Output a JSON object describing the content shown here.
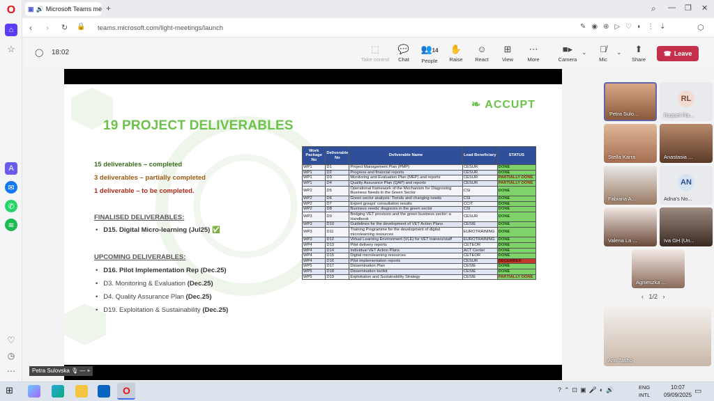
{
  "browser": {
    "tab_title": "Microsoft Teams meet",
    "url": "teams.microsoft.com/light-meetings/launch"
  },
  "meeting": {
    "timer": "18:02",
    "toolbar": {
      "take_control": "Take control",
      "chat": "Chat",
      "people": "People",
      "people_count": "14",
      "raise": "Raise",
      "react": "React",
      "view": "View",
      "more": "More",
      "camera": "Camera",
      "mic": "Mic",
      "share": "Share",
      "leave": "Leave"
    },
    "presenter_label": "Petra Sulovska"
  },
  "slide": {
    "title": "19 PROJECT DELIVERABLES",
    "logo": "ACCUPT",
    "summary": {
      "completed": "15 deliverables – completed",
      "partial": "3 deliverables – partially completed",
      "todo": "1 deliverable – to be completed."
    },
    "finalised_heading": "FINALISED DELIVERABLES:",
    "finalised": [
      {
        "text": "D15. Digital Micro-learning (Jul25) ✅"
      }
    ],
    "upcoming_heading": "UPCOMING DELIVERABLES:",
    "upcoming": [
      {
        "name": "D16. Pilot Implementation Rep",
        "date": "(Dec.25)"
      },
      {
        "name": "D3. Monitoring & Evaluation",
        "date": "(Dec.25)"
      },
      {
        "name": "D4. Quality Assurance Plan",
        "date": "(Dec.25)"
      },
      {
        "name": "D19. Exploitation & Sustainability",
        "date": "(Dec.25)"
      }
    ],
    "table": {
      "headers": [
        "Work Package No",
        "Deliverable No",
        "Deliverable Name",
        "Lead Beneficiary",
        "STATUS"
      ],
      "rows": [
        [
          "WP1",
          "D1",
          "Project Management Plan (PMP)",
          "CESUR",
          "DONE"
        ],
        [
          "WP1",
          "D2",
          "Progress and financial reports",
          "CESUR",
          "DONE"
        ],
        [
          "WP1",
          "D3",
          "Monitoring and Evaluation Plan (MEP) and reports",
          "CESUR",
          "PARTIALLY DONE"
        ],
        [
          "WP1",
          "D4",
          "Quality Assurance Plan (QAP) and reports",
          "CESUR",
          "PARTIALLY DONE"
        ],
        [
          "WP2",
          "D5",
          "Operational framework of the Mechanism for Diagnosing Business Needs in the Green Sector",
          "CSI",
          "DONE"
        ],
        [
          "WP2",
          "D6",
          "Green sector analysis: Trends and changing needs",
          "CSI",
          "DONE"
        ],
        [
          "WP2",
          "D7",
          "Expert groups' consultation results",
          "CCIT",
          "DONE"
        ],
        [
          "WP2",
          "D8",
          "Business needs' diagnosis in the green sector",
          "CSI",
          "DONE"
        ],
        [
          "WP3",
          "D9",
          "Bridging VET provision and the green business sector: a Handbook",
          "CESUR",
          "DONE"
        ],
        [
          "WP3",
          "D10",
          "Guidelines for the development of VET Action Plans",
          "CESIE",
          "DONE"
        ],
        [
          "WP3",
          "D11",
          "Training Programme for the development of digital microlearning resources",
          "EUROTRAINING",
          "DONE"
        ],
        [
          "WP3",
          "D12",
          "Virtual Learning Environment (VLE) for VET trainers/staff",
          "EUROTRAINING",
          "DONE"
        ],
        [
          "WP4",
          "D13",
          "Pilot delivery reports",
          "CETEOR",
          "DONE"
        ],
        [
          "WP4",
          "D14",
          "Individual VET Action Plans",
          "ACT Center",
          "DONE"
        ],
        [
          "WP4",
          "D15",
          "Digital microlearning resources",
          "CETEOR",
          "DONE"
        ],
        [
          "WP4",
          "D16",
          "Pilot implementation reports",
          "CESUR",
          "DECEMBER"
        ],
        [
          "WP5",
          "D17",
          "Dissemination Plan",
          "CESIE",
          "DONE"
        ],
        [
          "WP5",
          "D18",
          "Dissemination toolkit",
          "CESIE",
          "DONE"
        ],
        [
          "WP5",
          "D19",
          "Exploitation and Sustainability Strategy",
          "CESIE",
          "PARTIALLY DONE"
        ]
      ]
    }
  },
  "participants": [
    {
      "name": "Petra Sulo...",
      "initials": ""
    },
    {
      "name": "Raquel Pla...",
      "initials": "RL"
    },
    {
      "name": "Stella Karra",
      "initials": ""
    },
    {
      "name": "Anastasia ...",
      "initials": ""
    },
    {
      "name": "Fabiana A...",
      "initials": ""
    },
    {
      "name": "Adna's No...",
      "initials": "AN"
    },
    {
      "name": "Valeria La ...",
      "initials": ""
    },
    {
      "name": "Iva GH (Un...",
      "initials": ""
    },
    {
      "name": "Agnieszka ...",
      "initials": ""
    }
  ],
  "pager": "1/2",
  "self_view": "Aris Tasho",
  "taskbar": {
    "lang1": "ENG",
    "lang2": "INTL",
    "time": "10:07",
    "date": "09/09/2025"
  }
}
